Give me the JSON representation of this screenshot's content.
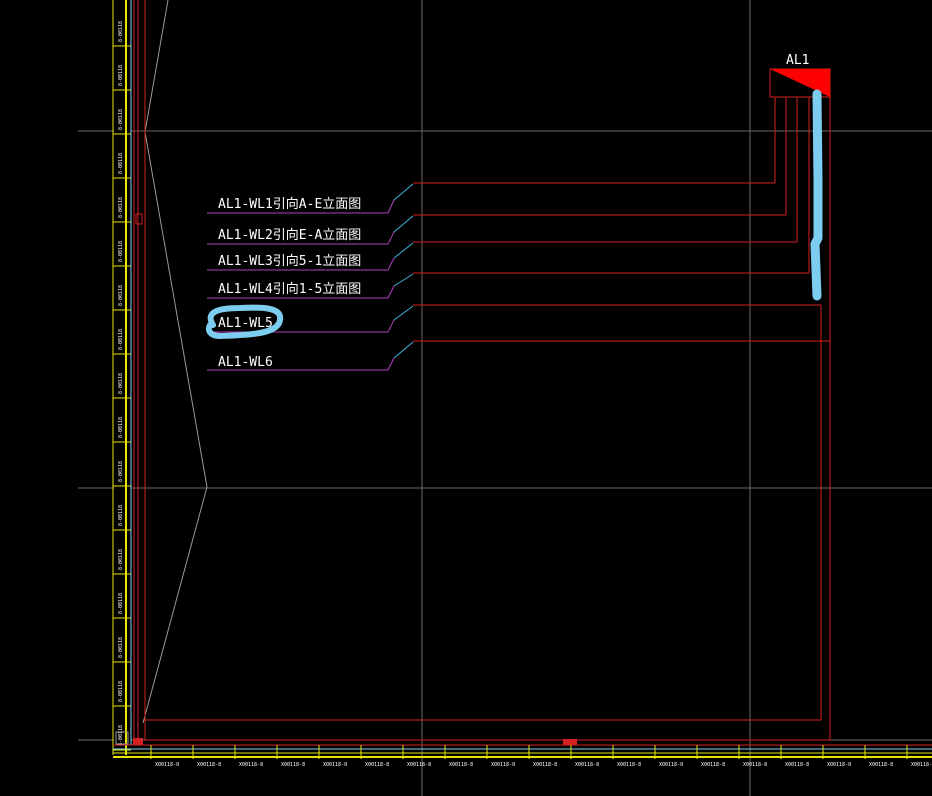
{
  "panel": {
    "label": "AL1"
  },
  "circuits": [
    {
      "label": "AL1-WL1引向A-E立面图"
    },
    {
      "label": "AL1-WL2引向E-A立面图"
    },
    {
      "label": "AL1-WL3引向5-1立面图"
    },
    {
      "label": "AL1-WL4引向1-5立面图"
    },
    {
      "label": "AL1-WL5"
    },
    {
      "label": "AL1-WL6"
    }
  ],
  "ruler": {
    "bottom_tick_text": "X00118-8",
    "left_tick_text": "8-00118"
  },
  "colors": {
    "background": "#000000",
    "wire": "#d42020",
    "leader": "#b040c0",
    "switch": "#40b0e0",
    "grid": "#6a6a6a",
    "highlight": "#7ccdf0",
    "frame_yellow": "#e6e600",
    "frame_cyan": "#7fd6f0",
    "panel_fill": "#ff0000"
  }
}
